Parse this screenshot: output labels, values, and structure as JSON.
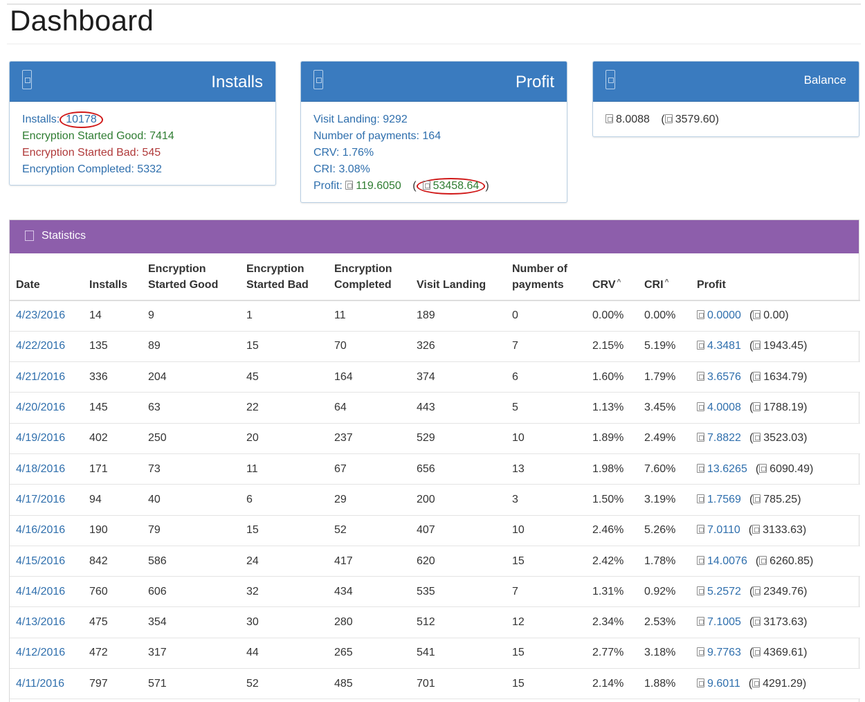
{
  "page": {
    "title": "Dashboard"
  },
  "installs_panel": {
    "title": "Installs",
    "installs_label": "Installs:",
    "installs_value": "10178",
    "enc_good": "Encryption Started Good: 7414",
    "enc_bad": "Encryption Started Bad: 545",
    "enc_completed": "Encryption Completed: 5332"
  },
  "profit_panel": {
    "title": "Profit",
    "visit_landing": "Visit Landing: 9292",
    "num_payments": "Number of payments: 164",
    "crv": "CRV: 1.76%",
    "cri": "CRI: 3.08%",
    "profit_label": "Profit:",
    "profit_btc": "119.6050",
    "profit_usd": "53458.64"
  },
  "balance_panel": {
    "title": "Balance",
    "btc": "8.0088",
    "usd": "3579.60"
  },
  "statistics": {
    "title": "Statistics",
    "headers": {
      "date": "Date",
      "installs": "Installs",
      "enc_good": "Encryption Started Good",
      "enc_bad": "Encryption Started Bad",
      "enc_completed": "Encryption Completed",
      "visit_landing": "Visit Landing",
      "num_payments": "Number of payments",
      "crv": "CRV",
      "cri": "CRI",
      "profit": "Profit"
    },
    "rows": [
      {
        "date": "4/23/2016",
        "installs": "14",
        "good": "9",
        "bad": "1",
        "completed": "11",
        "visit": "189",
        "payments": "0",
        "crv": "0.00%",
        "cri": "0.00%",
        "btc": "0.0000",
        "usd": "0.00"
      },
      {
        "date": "4/22/2016",
        "installs": "135",
        "good": "89",
        "bad": "15",
        "completed": "70",
        "visit": "326",
        "payments": "7",
        "crv": "2.15%",
        "cri": "5.19%",
        "btc": "4.3481",
        "usd": "1943.45"
      },
      {
        "date": "4/21/2016",
        "installs": "336",
        "good": "204",
        "bad": "45",
        "completed": "164",
        "visit": "374",
        "payments": "6",
        "crv": "1.60%",
        "cri": "1.79%",
        "btc": "3.6576",
        "usd": "1634.79"
      },
      {
        "date": "4/20/2016",
        "installs": "145",
        "good": "63",
        "bad": "22",
        "completed": "64",
        "visit": "443",
        "payments": "5",
        "crv": "1.13%",
        "cri": "3.45%",
        "btc": "4.0008",
        "usd": "1788.19"
      },
      {
        "date": "4/19/2016",
        "installs": "402",
        "good": "250",
        "bad": "20",
        "completed": "237",
        "visit": "529",
        "payments": "10",
        "crv": "1.89%",
        "cri": "2.49%",
        "btc": "7.8822",
        "usd": "3523.03"
      },
      {
        "date": "4/18/2016",
        "installs": "171",
        "good": "73",
        "bad": "11",
        "completed": "67",
        "visit": "656",
        "payments": "13",
        "crv": "1.98%",
        "cri": "7.60%",
        "btc": "13.6265",
        "usd": "6090.49"
      },
      {
        "date": "4/17/2016",
        "installs": "94",
        "good": "40",
        "bad": "6",
        "completed": "29",
        "visit": "200",
        "payments": "3",
        "crv": "1.50%",
        "cri": "3.19%",
        "btc": "1.7569",
        "usd": "785.25"
      },
      {
        "date": "4/16/2016",
        "installs": "190",
        "good": "79",
        "bad": "15",
        "completed": "52",
        "visit": "407",
        "payments": "10",
        "crv": "2.46%",
        "cri": "5.26%",
        "btc": "7.0110",
        "usd": "3133.63"
      },
      {
        "date": "4/15/2016",
        "installs": "842",
        "good": "586",
        "bad": "24",
        "completed": "417",
        "visit": "620",
        "payments": "15",
        "crv": "2.42%",
        "cri": "1.78%",
        "btc": "14.0076",
        "usd": "6260.85"
      },
      {
        "date": "4/14/2016",
        "installs": "760",
        "good": "606",
        "bad": "32",
        "completed": "434",
        "visit": "535",
        "payments": "7",
        "crv": "1.31%",
        "cri": "0.92%",
        "btc": "5.2572",
        "usd": "2349.76"
      },
      {
        "date": "4/13/2016",
        "installs": "475",
        "good": "354",
        "bad": "30",
        "completed": "280",
        "visit": "512",
        "payments": "12",
        "crv": "2.34%",
        "cri": "2.53%",
        "btc": "7.1005",
        "usd": "3173.63"
      },
      {
        "date": "4/12/2016",
        "installs": "472",
        "good": "317",
        "bad": "44",
        "completed": "265",
        "visit": "541",
        "payments": "15",
        "crv": "2.77%",
        "cri": "3.18%",
        "btc": "9.7763",
        "usd": "4369.61"
      },
      {
        "date": "4/11/2016",
        "installs": "797",
        "good": "571",
        "bad": "52",
        "completed": "485",
        "visit": "701",
        "payments": "15",
        "crv": "2.14%",
        "cri": "1.88%",
        "btc": "9.6011",
        "usd": "4291.29"
      }
    ]
  },
  "colors": {
    "panel_header": "#3a7bbf",
    "statistics_header": "#8d5eab",
    "link": "#2f6fad",
    "good": "#2f7d32",
    "bad": "#b03a3a",
    "highlight_circle": "#d01818"
  },
  "icons": {
    "panel_header": "document-icon",
    "currency": "bitcoin-icon"
  }
}
